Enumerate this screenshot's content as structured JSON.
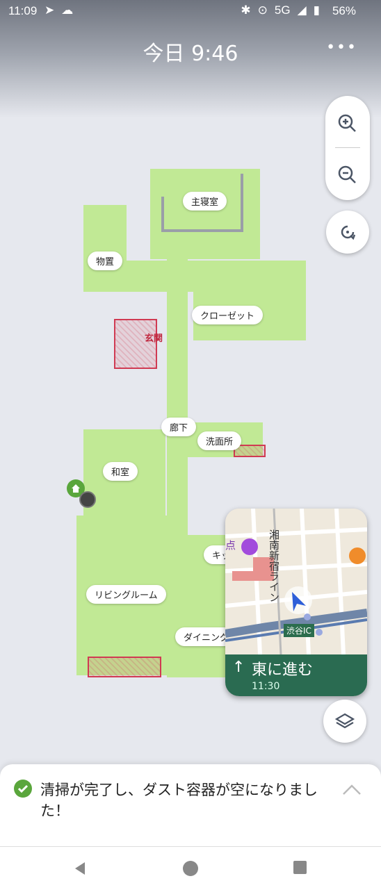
{
  "status_bar": {
    "time": "11:09",
    "network": "5G",
    "battery": "56%"
  },
  "header": {
    "title": "今日 9:46",
    "more_icon": "more-horizontal-icon"
  },
  "map": {
    "rooms": [
      "主寝室",
      "物置",
      "クローゼット",
      "玄関",
      "廊下",
      "洗面所",
      "和室",
      "キッ",
      "リビングルーム",
      "ダイニング"
    ],
    "colors": {
      "floor": "#c1e995",
      "no_go_zone": "#d03a52",
      "home_dock": "#5aa63c"
    }
  },
  "nav_card": {
    "route_label": "湘南新宿ライン",
    "place_label": "渋谷IC",
    "instruction": "東に進む",
    "eta": "11:30",
    "poi_label": "点"
  },
  "notification": {
    "message": "清掃が完了し、ダスト容器が空になりました！"
  },
  "controls": {
    "zoom_in_icon": "zoom-in-icon",
    "zoom_out_icon": "zoom-out-icon",
    "rotate_icon": "rotate-icon",
    "layers_icon": "layers-icon"
  }
}
